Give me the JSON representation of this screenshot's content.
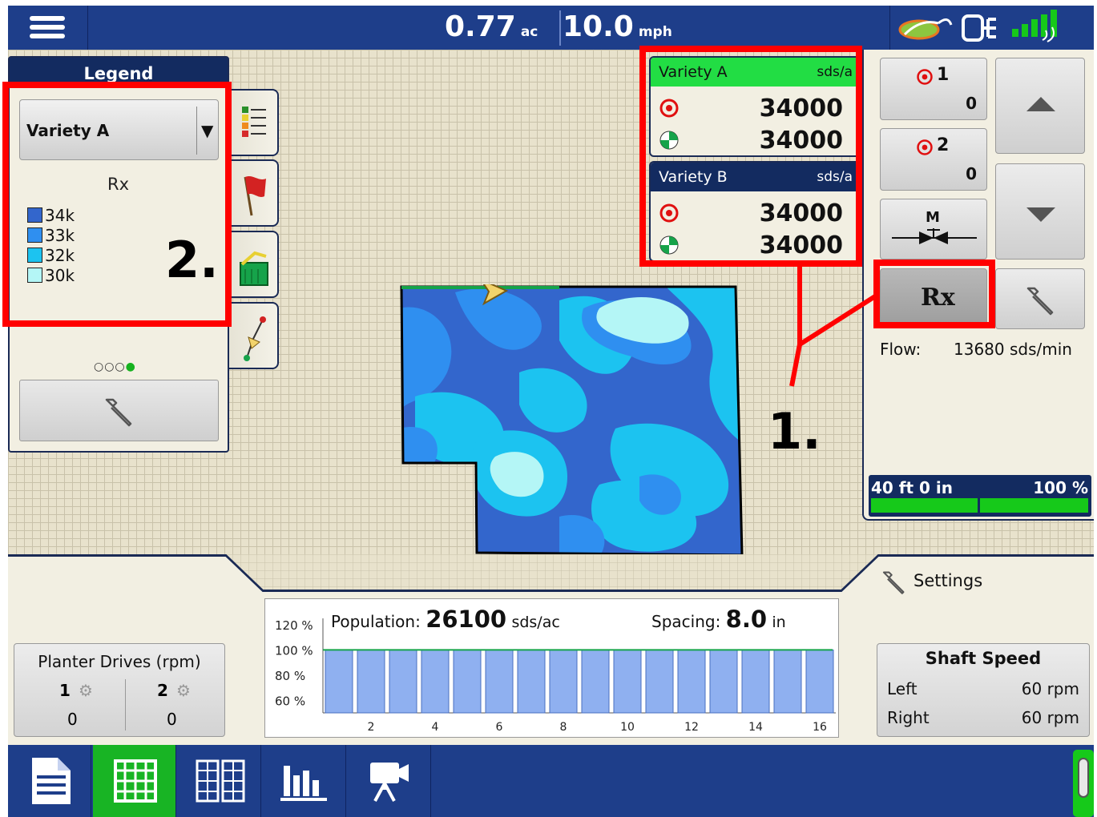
{
  "topbar": {
    "area_value": "0.77",
    "area_unit": "ac",
    "speed_value": "10.0",
    "speed_unit": "mph"
  },
  "legend": {
    "title": "Legend",
    "variety_selected": "Variety A",
    "layer_label": "Rx",
    "items": [
      {
        "label": "34k",
        "color": "#3366cc"
      },
      {
        "label": "33k",
        "color": "#2f8ff0"
      },
      {
        "label": "32k",
        "color": "#1cc3f0"
      },
      {
        "label": "30k",
        "color": "#b4f6f6"
      }
    ],
    "pages": 4,
    "active_page": 4
  },
  "varieties": [
    {
      "name": "Variety A",
      "unit": "sds/a",
      "target": "34000",
      "actual": "34000",
      "header_color": "#22dd44",
      "header_text_color": "#111111"
    },
    {
      "name": "Variety B",
      "unit": "sds/a",
      "target": "34000",
      "actual": "34000",
      "header_color": "#132b60",
      "header_text_color": "#ffffff"
    }
  ],
  "controls": {
    "product1": {
      "index": "1",
      "value": "0"
    },
    "product2": {
      "index": "2",
      "value": "0"
    },
    "manual_label": "M",
    "rx_label": "Rx"
  },
  "flow": {
    "label": "Flow:",
    "value": "13680 sds/min"
  },
  "implement": {
    "width": "40 ft 0 in",
    "percent": "100 %"
  },
  "settings_label": "Settings",
  "annotations": {
    "one": "1.",
    "two": "2."
  },
  "planter_drives": {
    "title": "Planter Drives (rpm)",
    "drives": [
      {
        "index": "1",
        "value": "0"
      },
      {
        "index": "2",
        "value": "0"
      }
    ]
  },
  "shaft_speed": {
    "title": "Shaft Speed",
    "rows": [
      {
        "label": "Left",
        "value": "60 rpm"
      },
      {
        "label": "Right",
        "value": "60 rpm"
      }
    ]
  },
  "population": {
    "label": "Population:",
    "value": "26100",
    "unit": "sds/ac",
    "spacing_label": "Spacing:",
    "spacing_value": "8.0",
    "spacing_unit": "in"
  },
  "chart_data": {
    "type": "bar",
    "categories": [
      "1",
      "2",
      "3",
      "4",
      "5",
      "6",
      "7",
      "8",
      "9",
      "10",
      "11",
      "12",
      "13",
      "14",
      "15",
      "16"
    ],
    "values": [
      100,
      100,
      100,
      100,
      100,
      100,
      100,
      100,
      100,
      100,
      100,
      100,
      100,
      100,
      100,
      100
    ],
    "x_tick_labels": [
      "2",
      "4",
      "6",
      "8",
      "10",
      "12",
      "14",
      "16"
    ],
    "y_tick_labels": [
      "120 %",
      "100 %",
      "80 %",
      "60 %"
    ],
    "ylim": [
      50,
      120
    ],
    "bar_color": "#8fb0f0",
    "target_line": 100
  },
  "nav": {
    "items": [
      "notes-icon",
      "map-grid-icon",
      "split-map-icon",
      "bar-chart-icon",
      "camera-icon"
    ],
    "active": 1
  }
}
